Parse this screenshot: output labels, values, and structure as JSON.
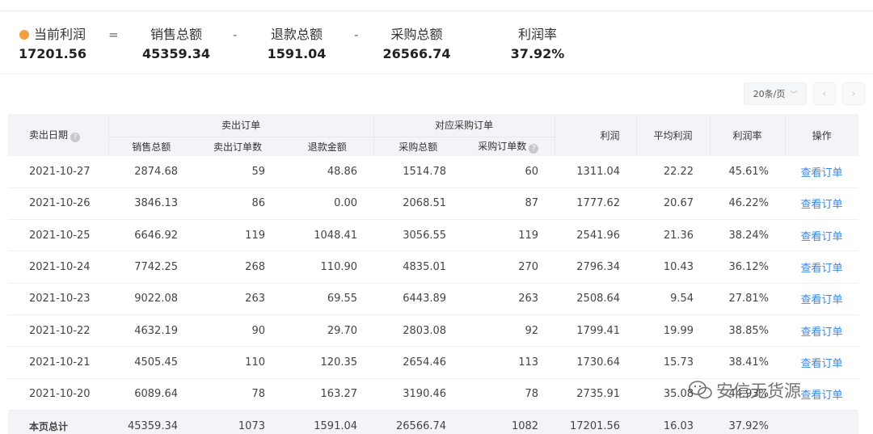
{
  "summary": {
    "profit_label": "当前利润",
    "profit_value": "17201.56",
    "op_equal": "=",
    "sales_label": "销售总额",
    "sales_value": "45359.34",
    "op_minus1": "-",
    "refund_label": "退款总额",
    "refund_value": "1591.04",
    "op_minus2": "-",
    "purchase_label": "采购总额",
    "purchase_value": "26566.74",
    "rate_label": "利润率",
    "rate_value": "37.92%"
  },
  "pager": {
    "page_size": "20条/页",
    "prev": "‹",
    "next": "›"
  },
  "table": {
    "headers": {
      "date": "卖出日期",
      "sell_group": "卖出订单",
      "purchase_group": "对应采购订单",
      "sales_total": "销售总额",
      "sell_count": "卖出订单数",
      "refund_amount": "退款金额",
      "purchase_total": "采购总额",
      "purchase_count": "采购订单数",
      "profit": "利润",
      "avg_profit": "平均利润",
      "rate": "利润率",
      "action": "操作"
    },
    "rows": [
      {
        "date": "2021-10-27",
        "sales": "2874.68",
        "count": "59",
        "refund": "48.86",
        "purchase": "1514.78",
        "pcount": "60",
        "profit": "1311.04",
        "avg": "22.22",
        "rate": "45.61%",
        "action": "查看订单"
      },
      {
        "date": "2021-10-26",
        "sales": "3846.13",
        "count": "86",
        "refund": "0.00",
        "purchase": "2068.51",
        "pcount": "87",
        "profit": "1777.62",
        "avg": "20.67",
        "rate": "46.22%",
        "action": "查看订单"
      },
      {
        "date": "2021-10-25",
        "sales": "6646.92",
        "count": "119",
        "refund": "1048.41",
        "purchase": "3056.55",
        "pcount": "119",
        "profit": "2541.96",
        "avg": "21.36",
        "rate": "38.24%",
        "action": "查看订单"
      },
      {
        "date": "2021-10-24",
        "sales": "7742.25",
        "count": "268",
        "refund": "110.90",
        "purchase": "4835.01",
        "pcount": "270",
        "profit": "2796.34",
        "avg": "10.43",
        "rate": "36.12%",
        "action": "查看订单"
      },
      {
        "date": "2021-10-23",
        "sales": "9022.08",
        "count": "263",
        "refund": "69.55",
        "purchase": "6443.89",
        "pcount": "263",
        "profit": "2508.64",
        "avg": "9.54",
        "rate": "27.81%",
        "action": "查看订单"
      },
      {
        "date": "2021-10-22",
        "sales": "4632.19",
        "count": "90",
        "refund": "29.70",
        "purchase": "2803.08",
        "pcount": "92",
        "profit": "1799.41",
        "avg": "19.99",
        "rate": "38.85%",
        "action": "查看订单"
      },
      {
        "date": "2021-10-21",
        "sales": "4505.45",
        "count": "110",
        "refund": "120.35",
        "purchase": "2654.46",
        "pcount": "113",
        "profit": "1730.64",
        "avg": "15.73",
        "rate": "38.41%",
        "action": "查看订单"
      },
      {
        "date": "2021-10-20",
        "sales": "6089.64",
        "count": "78",
        "refund": "163.27",
        "purchase": "3190.46",
        "pcount": "78",
        "profit": "2735.91",
        "avg": "35.08",
        "rate": "44.93%",
        "action": "查看订单"
      }
    ],
    "total": {
      "label": "本页总计",
      "sales": "45359.34",
      "count": "1073",
      "refund": "1591.04",
      "purchase": "26566.74",
      "pcount": "1082",
      "profit": "17201.56",
      "avg": "16.03",
      "rate": "37.92%"
    }
  },
  "watermark": {
    "text": "安信无货源",
    "icon": "wechat-icon"
  }
}
